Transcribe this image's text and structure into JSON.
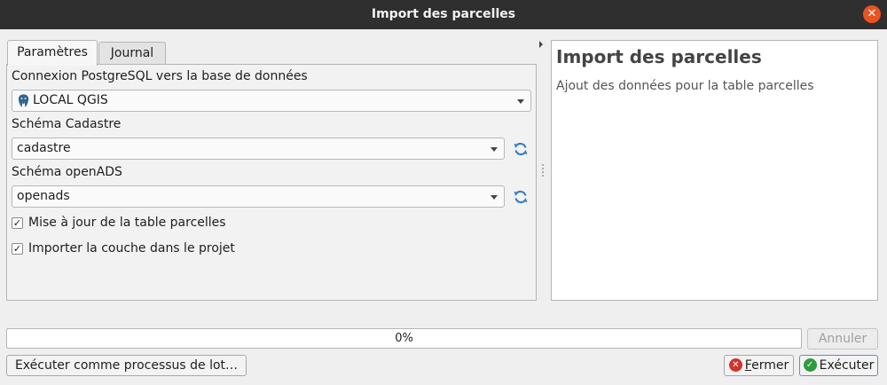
{
  "window": {
    "title": "Import des parcelles"
  },
  "tabs": [
    {
      "label": "Paramètres",
      "active": true
    },
    {
      "label": "Journal",
      "active": false
    }
  ],
  "params": {
    "connection_label": "Connexion PostgreSQL vers la base de données",
    "connection_value": "LOCAL QGIS",
    "schema_cadastre_label": "Schéma Cadastre",
    "schema_cadastre_value": "cadastre",
    "schema_openads_label": "Schéma openADS",
    "schema_openads_value": "openads",
    "checks": [
      {
        "label": "Mise à jour de la table parcelles",
        "checked": true
      },
      {
        "label": "Importer la couche dans le projet",
        "checked": true
      }
    ]
  },
  "help": {
    "title": "Import des parcelles",
    "description": "Ajout des données pour la table parcelles"
  },
  "progress": {
    "value": 0,
    "text": "0%"
  },
  "buttons": {
    "cancel": "Annuler",
    "batch": "Exécuter comme processus de lot…",
    "close_rest": "ermer",
    "close_accel": "F",
    "run": "Exécuter"
  },
  "colors": {
    "titlebar": "#2f2f2f",
    "close": "#e95420",
    "refresh": "#3a7fc1",
    "run_icon": "#2e9c3e",
    "close_icon": "#d0342c"
  }
}
